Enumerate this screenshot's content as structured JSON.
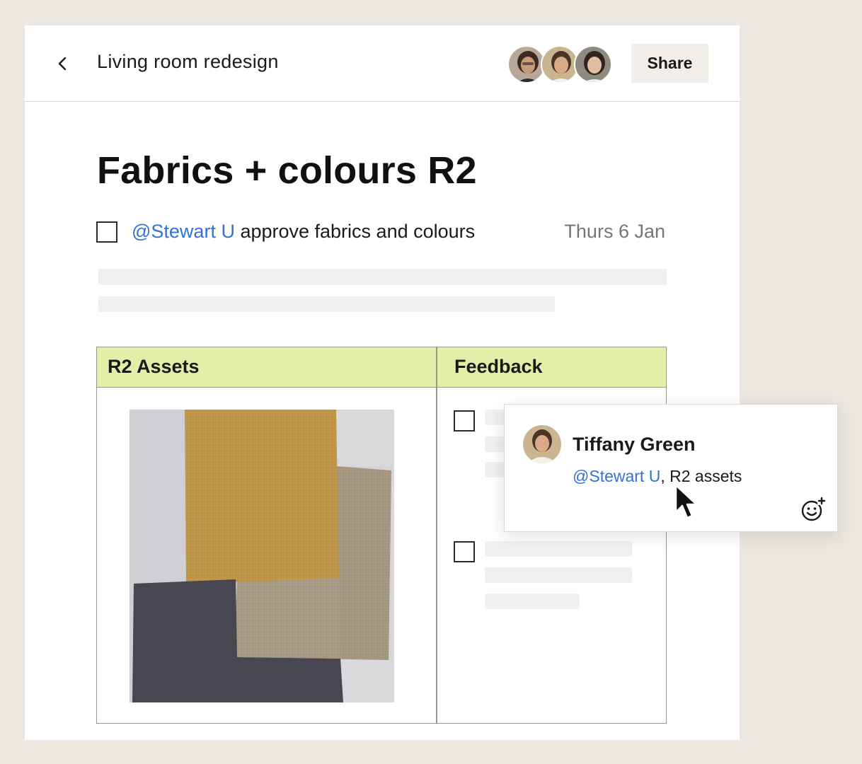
{
  "header": {
    "doc_title": "Living room redesign",
    "share_label": "Share",
    "collaborators": [
      "collaborator-1",
      "collaborator-2",
      "collaborator-3"
    ]
  },
  "page": {
    "heading": "Fabrics + colours R2"
  },
  "task": {
    "mention": "@Stewart U",
    "text": " approve fabrics and colours",
    "date": "Thurs 6 Jan",
    "checked": false
  },
  "table": {
    "headers": [
      "R2 Assets",
      "Feedback"
    ],
    "header_color": "#e2efa9"
  },
  "comment": {
    "author": "Tiffany Green",
    "mention": "@Stewart U",
    "text": ", R2 assets"
  },
  "icons": {
    "back": "chevron-left-icon",
    "reaction": "add-reaction-icon",
    "cursor": "mouse-pointer-icon"
  },
  "colors": {
    "mention": "#3570d8",
    "background": "#ece8e1"
  }
}
